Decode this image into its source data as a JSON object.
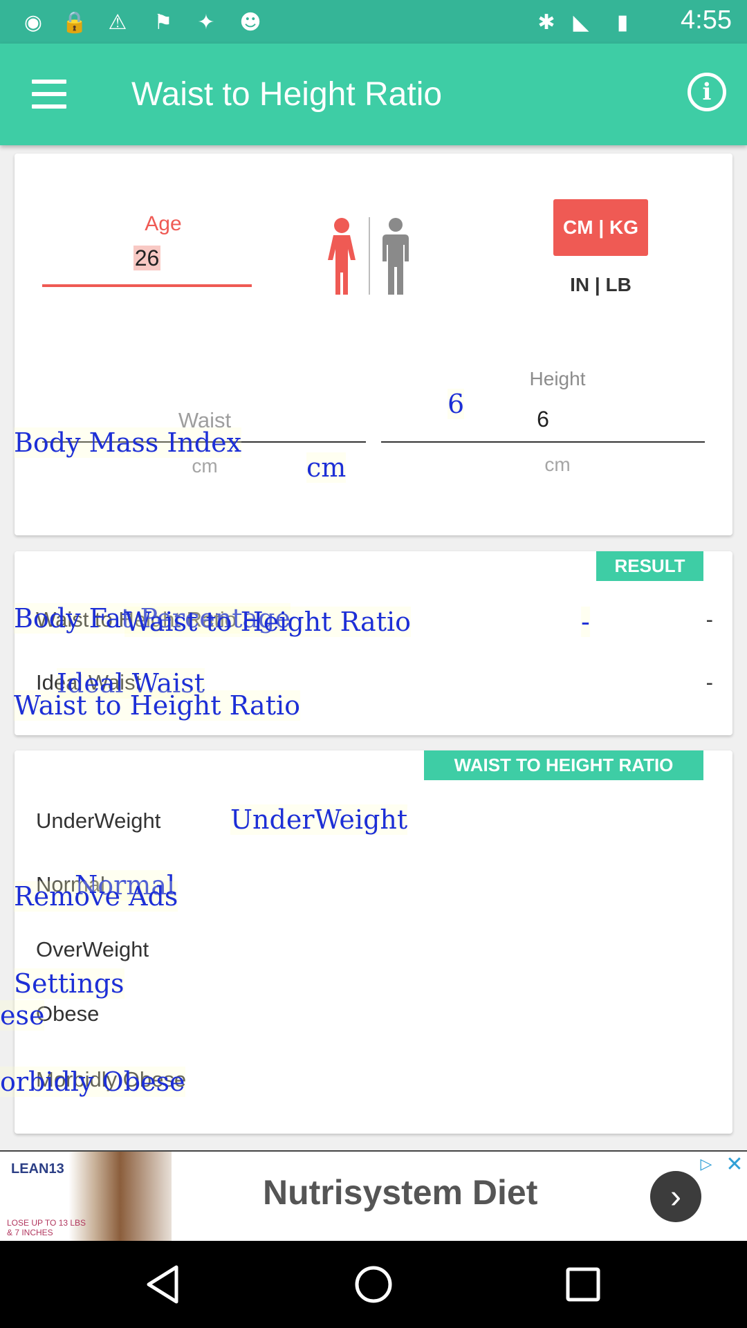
{
  "status_bar": {
    "time": "4:55",
    "icons": [
      "notification-icon",
      "lock-icon",
      "warning-icon",
      "fake-gps-icon",
      "satellite-icon",
      "android-icon",
      "bluetooth-icon",
      "signal-icon",
      "battery-icon"
    ]
  },
  "toolbar": {
    "title": "Waist to Height Ratio",
    "menu_icon": "hamburger-menu-icon",
    "info_icon": "info-icon",
    "info_glyph": "i"
  },
  "inputs": {
    "age_label": "Age",
    "age_value": "26",
    "unit_metric": "CM | KG",
    "unit_imperial": "IN | LB",
    "waist_label": "Waist",
    "waist_unit": "cm",
    "height_label": "Height",
    "height_value": "6",
    "height_unit": "cm",
    "colors": {
      "accent": "#ef5a54",
      "female": "#ef5a54",
      "male": "#8a8a8a"
    }
  },
  "result": {
    "badge": "RESULT",
    "rows": [
      {
        "label": "Waist to Height Ratio",
        "value": "-"
      },
      {
        "label": "Ideal Waist",
        "value": "-"
      }
    ]
  },
  "categories": {
    "badge": "WAIST TO HEIGHT RATIO",
    "items": [
      "UnderWeight",
      "Normal",
      "OverWeight",
      "Obese",
      "Morbidly Obese"
    ]
  },
  "overlay": {
    "body_mass_index": "Body Mass Index",
    "six": "6",
    "cm": "cm",
    "body_fat": "Body Fat Percentage",
    "wthr_row": "Waist to Height Ratio",
    "dash": "-",
    "ideal_waist": "Ideal Waist",
    "wthr_menu": "Waist to Height Ratio",
    "underweight": "UnderWeight",
    "normal": "Normal",
    "remove_ads": "Remove Ads",
    "settings": "Settings",
    "obese": "ese",
    "morbidly_obese": "orbidly Obese"
  },
  "ad": {
    "title": "Nutrisystem Diet",
    "image_text": "LEAN13",
    "promo_text": "LOSE UP TO 13 LBS & 7 INCHES",
    "arrow": "›",
    "choices": "▷",
    "close": "✕"
  },
  "colors": {
    "primary": "#3ecda5",
    "status_bar": "#35b597",
    "accent": "#ef5a54"
  }
}
